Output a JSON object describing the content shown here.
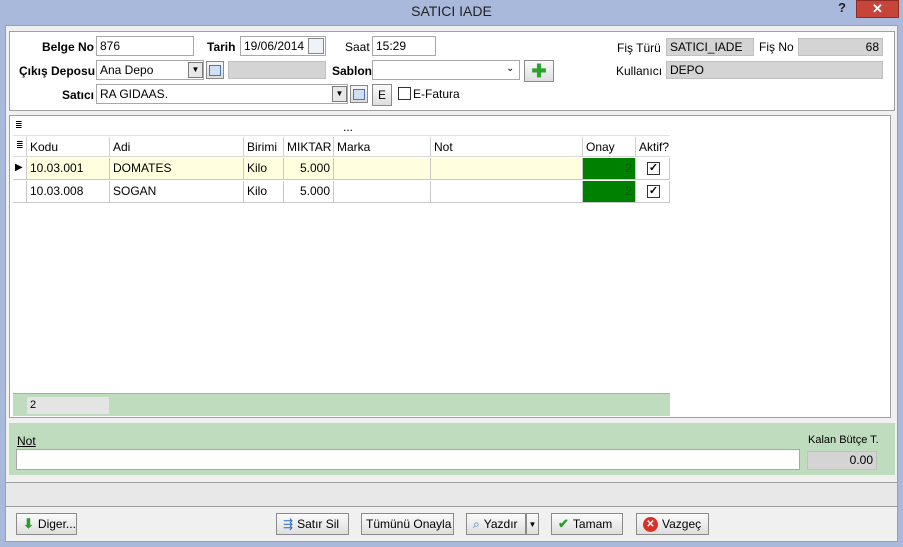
{
  "window": {
    "title": "SATICI IADE",
    "help": "?",
    "close": "✕"
  },
  "header": {
    "belge_no_label": "Belge No",
    "belge_no_value": "876",
    "tarih_label": "Tarih",
    "tarih_value": "19/06/2014",
    "saat_label": "Saat",
    "saat_value": "15:29",
    "cikis_deposu_label": "Çıkış Deposu",
    "cikis_deposu_value": "Ana Depo",
    "sablon_label": "Sablon",
    "sablon_value": "",
    "satici_label": "Satıcı",
    "satici_value": "RA GIDAAS.",
    "e_button": "E",
    "efatura_label": "E-Fatura",
    "fis_turu_label": "Fiş Türü",
    "fis_turu_value": "SATICI_IADE",
    "fis_no_label": "Fiş No",
    "fis_no_value": "68",
    "kullanici_label": "Kullanıcı",
    "kullanici_value": "DEPO"
  },
  "grid": {
    "group_row": "...",
    "columns": [
      "Kodu",
      "Adi",
      "Birimi",
      "MIKTAR",
      "Marka",
      "Not",
      "Onay",
      "Aktif?"
    ],
    "rows": [
      {
        "kodu": "10.03.001",
        "adi": "DOMATES",
        "birimi": "Kilo",
        "miktar": "5.000",
        "marka": "",
        "not": "",
        "onay": "2",
        "aktif": true
      },
      {
        "kodu": "10.03.008",
        "adi": "SOGAN",
        "birimi": "Kilo",
        "miktar": "5.000",
        "marka": "",
        "not": "",
        "onay": "2",
        "aktif": true
      }
    ],
    "footer_count": "2"
  },
  "bottom": {
    "not_label": "Not",
    "not_value": "",
    "kalan_butce_label": "Kalan Bütçe T.",
    "kalan_butce_value": "0.00"
  },
  "buttons": {
    "diger": "Diger...",
    "satir_sil": "Satır Sil",
    "tumunu_onayla": "Tümünü Onayla",
    "yazdir": "Yazdır",
    "tamam": "Tamam",
    "vazgec": "Vazgeç"
  },
  "colors": {
    "onay_green": "#008000",
    "selected_row": "#ffffe0",
    "footer_green": "#bfdcbf"
  }
}
